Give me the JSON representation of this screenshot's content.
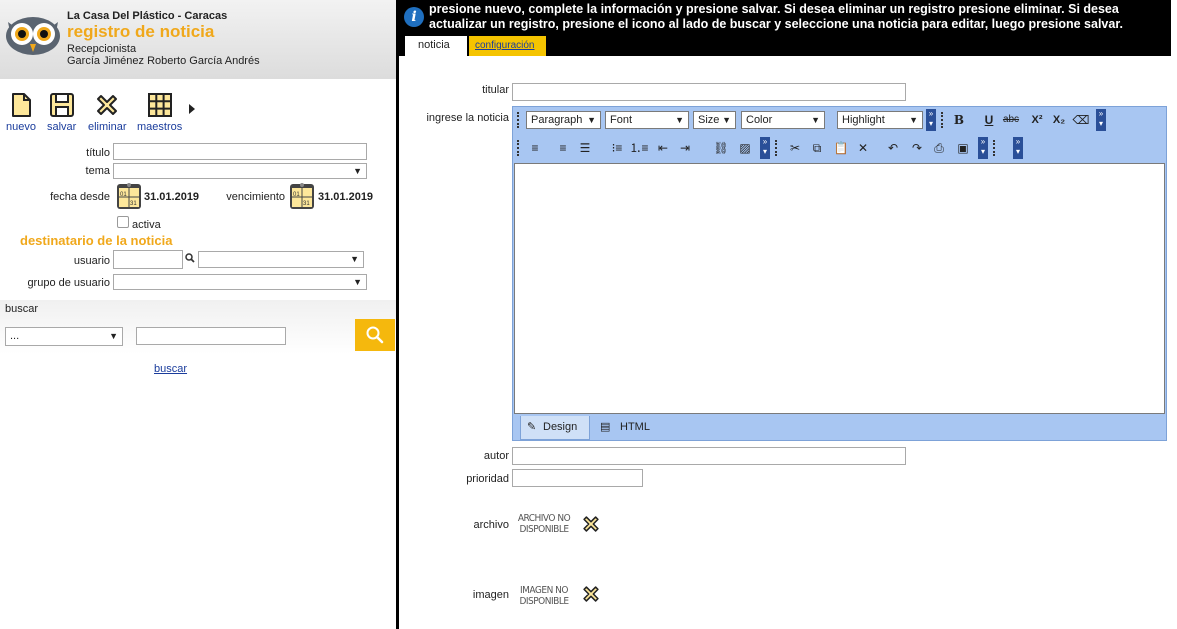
{
  "header": {
    "company": "La Casa Del Plástico - Caracas",
    "title": "registro de noticia",
    "role": "Recepcionista",
    "user": "García Jiménez Roberto García Andrés"
  },
  "toolbar": {
    "nuevo": "nuevo",
    "salvar": "salvar",
    "eliminar": "eliminar",
    "maestros": "maestros"
  },
  "form": {
    "titulo_label": "título",
    "tema_label": "tema",
    "fecha_desde_label": "fecha desde",
    "fecha_desde_value": "31.01.2019",
    "vencimiento_label": "vencimiento",
    "vencimiento_value": "31.01.2019",
    "activa_label": "activa",
    "destinatario_heading": "destinatario de la noticia",
    "usuario_label": "usuario",
    "grupo_label": "grupo de usuario",
    "calendar_day_top": "01",
    "calendar_day_bottom": "31"
  },
  "search": {
    "label": "buscar",
    "select_value": "...",
    "link": "buscar"
  },
  "info": {
    "text": "presione nuevo, complete la información y presione salvar. Si desea eliminar un registro presione eliminar. Si desea actualizar un registro, presione el icono al lado de buscar y seleccione una noticia para editar, luego presione salvar."
  },
  "tabs": {
    "noticia": "noticia",
    "configuracion": "configuración"
  },
  "main": {
    "titular_label": "titular",
    "ingrese_label": "ingrese la noticia",
    "autor_label": "autor",
    "prioridad_label": "prioridad",
    "archivo_label": "archivo",
    "archivo_na_line1": "ARCHIVO NO",
    "archivo_na_line2": "DISPONIBLE",
    "imagen_label": "imagen",
    "imagen_na_line1": "IMAGEN NO",
    "imagen_na_line2": "DISPONIBLE"
  },
  "editor": {
    "paragraph": "Paragraph",
    "font": "Font",
    "size": "Size",
    "color": "Color",
    "highlight": "Highlight",
    "design_tab": "Design",
    "html_tab": "HTML"
  },
  "colors": {
    "accent": "#f0a81b",
    "link": "#1a3c9c",
    "editor_bg": "#a8c6f2",
    "info_bg": "#000000"
  }
}
